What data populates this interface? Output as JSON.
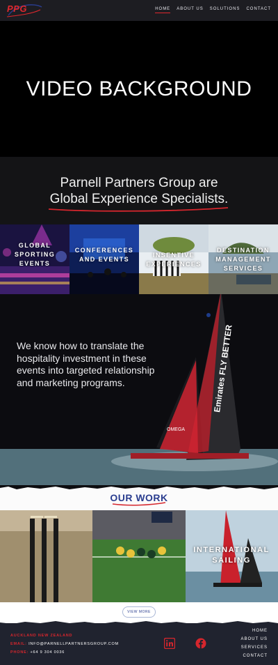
{
  "header": {
    "logo_text": "PPG",
    "nav": [
      {
        "label": "HOME",
        "active": true
      },
      {
        "label": "ABOUT US",
        "active": false
      },
      {
        "label": "SOLUTIONS",
        "active": false
      },
      {
        "label": "CONTACT",
        "active": false
      }
    ]
  },
  "hero": {
    "title": "VIDEO BACKGROUND"
  },
  "tagline": {
    "line1": "Parnell Partners Group are",
    "line2_main": "Global Experience Specialists",
    "line2_end": "."
  },
  "services": [
    {
      "label": "GLOBAL SPORTING EVENTS"
    },
    {
      "label": "CONFERENCES AND EVENTS"
    },
    {
      "label": "INSENTIVE EXPERIENCES"
    },
    {
      "label": "DESTINATION MANAGEMENT SERVICES"
    }
  ],
  "feature": {
    "text": "We know how to translate the hospitality investment in these events into targeted relationship and marketing programs."
  },
  "our_work": {
    "title": "OUR WORK",
    "items": [
      {
        "label": ""
      },
      {
        "label": ""
      },
      {
        "label": "INTERNATIONAL SAILING"
      }
    ],
    "button": "VIEW MORE"
  },
  "footer": {
    "location": "AUCKLAND NEW ZEALAND",
    "email_label": "EMAIL:",
    "email": "INFO@PARNELLPARTNERSGROUP.COM",
    "phone_label": "PHONE:",
    "phone": "+64 9 304 0036",
    "links": [
      "HOME",
      "ABOUT US",
      "SERVICES",
      "CONTACT"
    ],
    "social_icons": [
      "linkedin-icon",
      "facebook-icon"
    ]
  },
  "colors": {
    "accent_red": "#e0282e",
    "navy": "#2a3d8f",
    "footer_bg": "#20232f"
  }
}
